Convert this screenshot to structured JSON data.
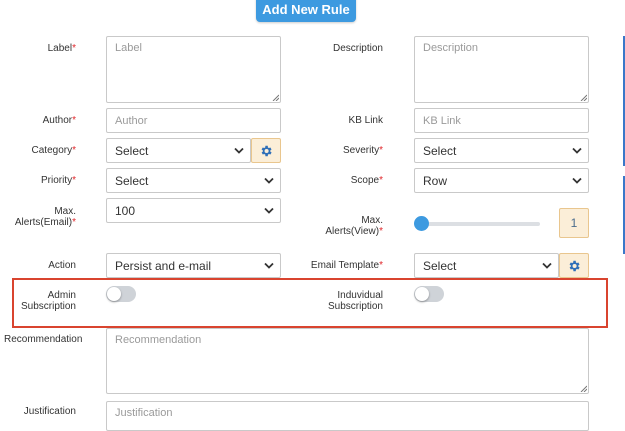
{
  "header": {
    "add_rule_button": "Add New Rule"
  },
  "form": {
    "label": {
      "label": "Label",
      "placeholder": "Label"
    },
    "description": {
      "label": "Description",
      "placeholder": "Description"
    },
    "author": {
      "label": "Author",
      "placeholder": "Author"
    },
    "kb_link": {
      "label": "KB Link",
      "placeholder": "KB Link"
    },
    "category": {
      "label": "Category",
      "value": "Select"
    },
    "severity": {
      "label": "Severity",
      "value": "Select"
    },
    "priority": {
      "label": "Priority",
      "value": "Select"
    },
    "scope": {
      "label": "Scope",
      "value": "Row"
    },
    "max_alerts_email": {
      "label_line1": "Max.",
      "label_line2": "Alerts(Email)",
      "value": "100"
    },
    "max_alerts_view": {
      "label_line1": "Max.",
      "label_line2": "Alerts(View)",
      "value": "1",
      "slider_fraction": 0.0
    },
    "action": {
      "label": "Action",
      "value": "Persist and e-mail"
    },
    "email_template": {
      "label": "Email Template",
      "value": "Select"
    },
    "admin_subscription": {
      "label_line1": "Admin",
      "label_line2": "Subscription",
      "enabled": false
    },
    "individual_subscription": {
      "label_line1": "Induvidual",
      "label_line2": "Subscription",
      "enabled": false
    },
    "recommendation": {
      "label": "Recommendation",
      "placeholder": "Recommendation"
    },
    "justification": {
      "label": "Justification",
      "placeholder": "Justification"
    }
  },
  "required_marker": "*",
  "icons": {
    "gear": "gear-icon",
    "chevron": "chevron-down-icon"
  },
  "colors": {
    "accent": "#3d9ae0",
    "required": "#e0262a",
    "highlight": "#d9442f",
    "gear_bg": "#fbeed8"
  }
}
